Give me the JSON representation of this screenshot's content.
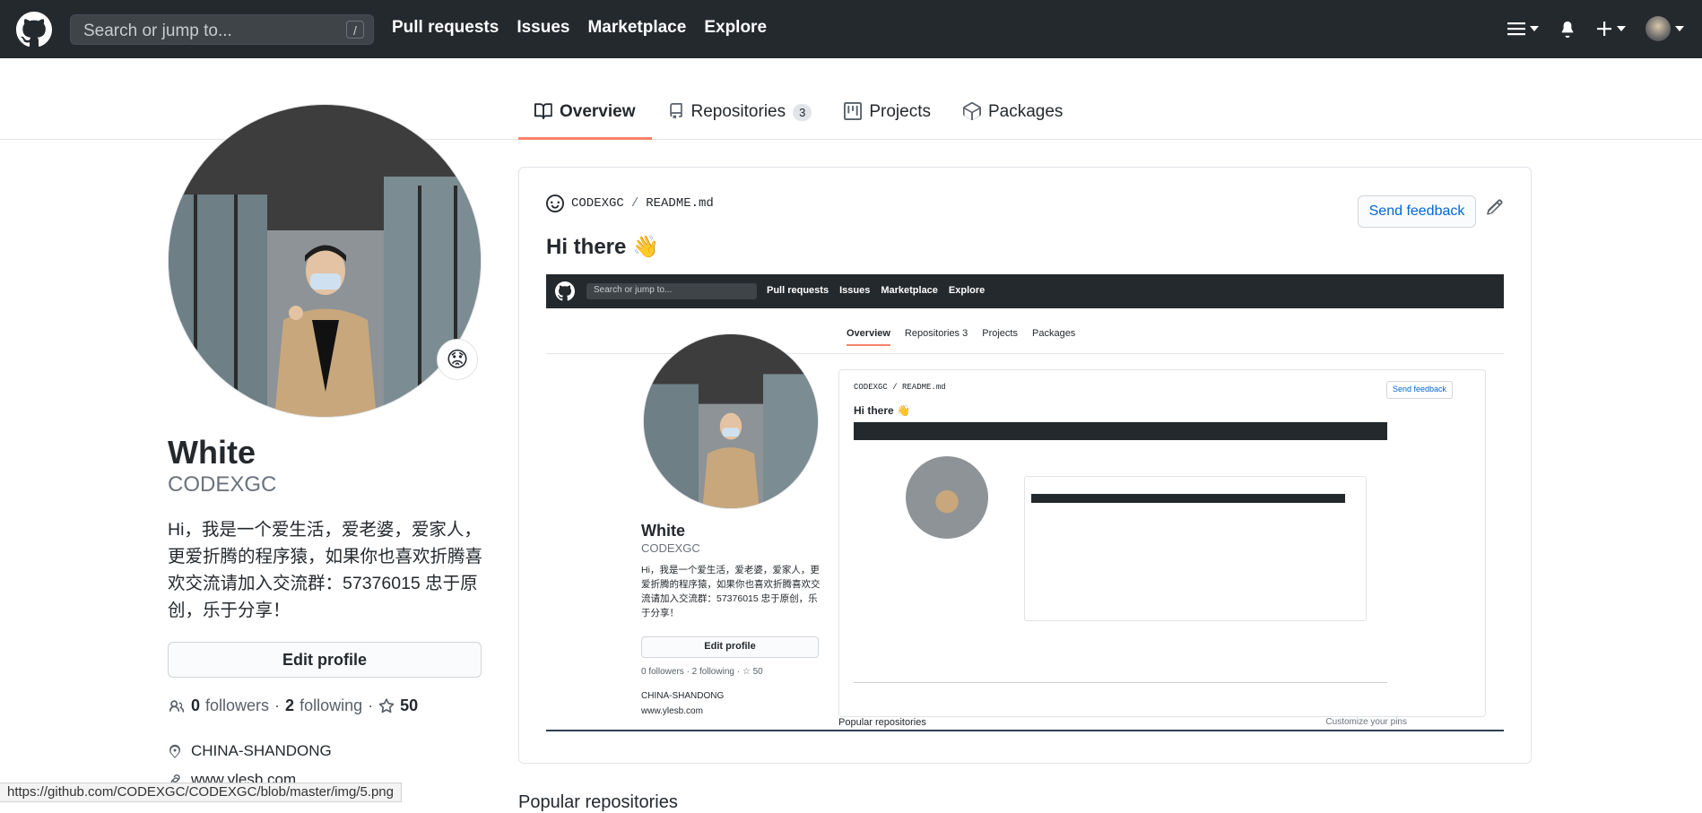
{
  "header": {
    "search_placeholder": "Search or jump to...",
    "search_shortcut": "/",
    "nav": [
      "Pull requests",
      "Issues",
      "Marketplace",
      "Explore"
    ]
  },
  "tabs": [
    {
      "label": "Overview",
      "active": true,
      "icon": "book-icon"
    },
    {
      "label": "Repositories",
      "count": "3",
      "icon": "repo-icon"
    },
    {
      "label": "Projects",
      "icon": "project-icon"
    },
    {
      "label": "Packages",
      "icon": "package-icon"
    }
  ],
  "profile": {
    "name": "White",
    "login": "CODEXGC",
    "bio": "Hi，我是一个爱生活，爱老婆，爱家人，更爱折腾的程序猿，如果你也喜欢折腾喜欢交流请加入交流群：57376015 忠于原创，乐于分享！",
    "edit_label": "Edit profile",
    "followers_count": "0",
    "followers_label": "followers",
    "following_count": "2",
    "following_label": "following",
    "stars": "50",
    "location": "CHINA-SHANDONG",
    "website": "www.ylesb.com",
    "status_emoji": "😟"
  },
  "readme": {
    "owner": "CODEXGC",
    "separator": "/",
    "file": "README.md",
    "send_feedback": "Send feedback",
    "heading": "Hi there 👋"
  },
  "embedded": {
    "search_placeholder": "Search or jump to...",
    "slash": "/",
    "nav": [
      "Pull requests",
      "Issues",
      "Marketplace",
      "Explore"
    ],
    "tabs": [
      "Overview",
      "Repositories",
      "3",
      "Projects",
      "Packages"
    ],
    "name": "White",
    "login": "CODEXGC",
    "bio": "Hi，我是一个爱生活，爱老婆，爱家人，更爱折腾的程序猿，如果你也喜欢折腾喜欢交流请加入交流群：57376015 忠于原创，乐于分享！",
    "edit_label": "Edit profile",
    "follow_text": "0 followers · 2 following · ☆ 50",
    "location": "CHINA-SHANDONG",
    "website": "www.ylesb.com",
    "path": "CODEXGC / README.md",
    "send_feedback": "Send feedback",
    "heading": "Hi there 👋",
    "popular": "Popular repositories",
    "customize": "Customize your pins"
  },
  "status_url": "https://github.com/CODEXGC/CODEXGC/blob/master/img/5.png",
  "popular_heading": "Popular repositories"
}
